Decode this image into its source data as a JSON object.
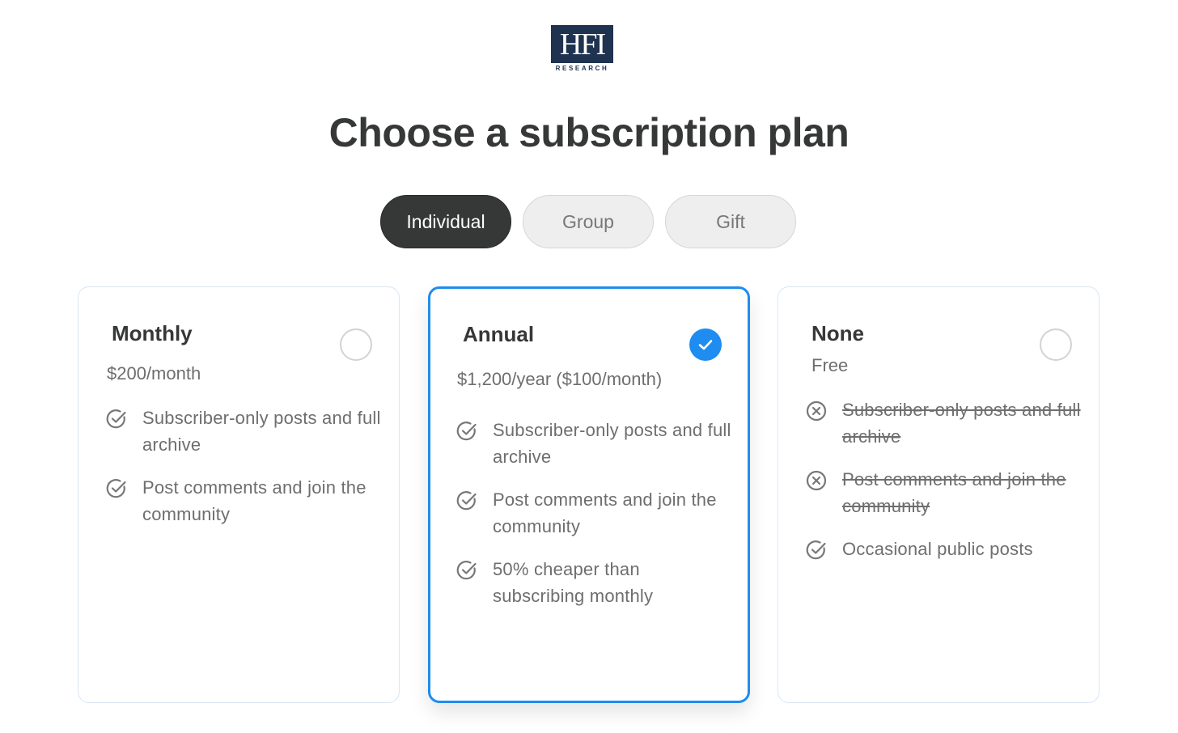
{
  "logo": {
    "mark": "HFI",
    "subtitle": "RESEARCH",
    "brand_color": "#1f3350"
  },
  "page_title": "Choose a subscription plan",
  "tabs": [
    {
      "label": "Individual",
      "active": true
    },
    {
      "label": "Group",
      "active": false
    },
    {
      "label": "Gift",
      "active": false
    }
  ],
  "colors": {
    "accent": "#1e8cf0",
    "text_dark": "#363737",
    "text_muted": "#6e6e6e"
  },
  "plans": [
    {
      "name": "Monthly",
      "price": "$200/month",
      "selected": false,
      "features": [
        {
          "text": "Subscriber-only posts and full archive",
          "included": true,
          "icon": "check-circle-icon"
        },
        {
          "text": "Post comments and join the community",
          "included": true,
          "icon": "check-circle-icon"
        }
      ]
    },
    {
      "name": "Annual",
      "price": "$1,200/year ($100/month)",
      "selected": true,
      "features": [
        {
          "text": "Subscriber-only posts and full archive",
          "included": true,
          "icon": "check-circle-icon"
        },
        {
          "text": "Post comments and join the community",
          "included": true,
          "icon": "check-circle-icon"
        },
        {
          "text": "50% cheaper than subscribing monthly",
          "included": true,
          "icon": "check-circle-icon"
        }
      ]
    },
    {
      "name": "None",
      "price": "Free",
      "selected": false,
      "features": [
        {
          "text": "Subscriber-only posts and full archive",
          "included": false,
          "icon": "x-circle-icon"
        },
        {
          "text": "Post comments and join the community",
          "included": false,
          "icon": "x-circle-icon"
        },
        {
          "text": "Occasional public posts",
          "included": true,
          "icon": "check-circle-icon"
        }
      ]
    }
  ]
}
